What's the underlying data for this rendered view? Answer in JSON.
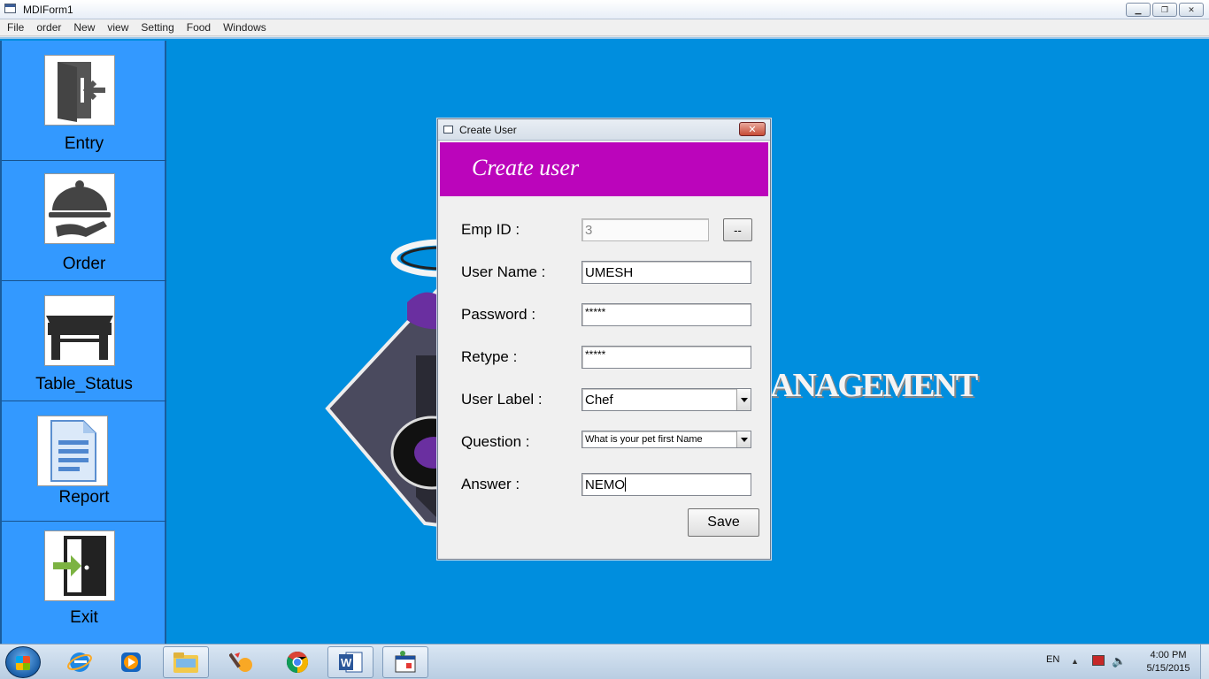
{
  "window": {
    "title": "MDIForm1"
  },
  "menu": [
    "File",
    "order",
    "New",
    "view",
    "Setting",
    "Food",
    "Windows"
  ],
  "sidebar": {
    "items": [
      {
        "label": "Entry",
        "icon": "entry-door-icon"
      },
      {
        "label": "Order",
        "icon": "serving-tray-icon"
      },
      {
        "label": "Table_Status",
        "icon": "table-icon"
      },
      {
        "label": "Report",
        "icon": "report-document-icon"
      },
      {
        "label": "Exit",
        "icon": "exit-door-icon"
      }
    ]
  },
  "background": {
    "wordmark": "ANAGEMENT"
  },
  "dialog": {
    "title": "Create User",
    "banner": "Create user",
    "fields": {
      "emp_id": {
        "label": "Emp ID :",
        "value": "3"
      },
      "emp_button": "--",
      "user_name": {
        "label": "User Name :",
        "value": "UMESH"
      },
      "password": {
        "label": "Password :",
        "value": "*****"
      },
      "retype": {
        "label": "Retype :",
        "value": "*****"
      },
      "user_label": {
        "label": "User Label :",
        "value": "Chef"
      },
      "question": {
        "label": "Question :",
        "value": "What is your pet first Name"
      },
      "answer": {
        "label": "Answer :",
        "value": "NEMO"
      }
    },
    "save_label": "Save"
  },
  "taskbar": {
    "apps": [
      "internet-explorer",
      "media-player",
      "file-explorer",
      "utility",
      "chrome",
      "word",
      "vb-app"
    ],
    "lang": "EN",
    "time": "4:00 PM",
    "date": "5/15/2015"
  },
  "colors": {
    "mdi_bg": "#008ede",
    "sidebar_bg": "#3399ff",
    "banner": "#bb05bb"
  }
}
